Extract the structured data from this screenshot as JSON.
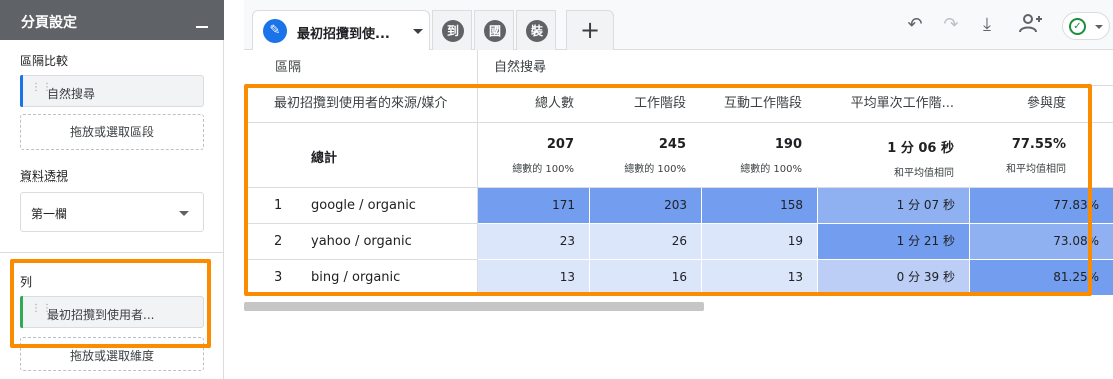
{
  "left_panel": {
    "title": "分頁設定",
    "segment_compare": {
      "label": "區隔比較",
      "chip": "自然搜尋",
      "drop": "拖放或選取區段"
    },
    "pivot": {
      "label": "資料透視",
      "value": "第一欄"
    },
    "rows": {
      "label": "列",
      "chip": "最初招攬到使用者...",
      "drop": "拖放或選取維度"
    }
  },
  "tabs": {
    "active_label": "最初招攬到使...",
    "mini": [
      "到",
      "國",
      "裝"
    ],
    "plus": "+"
  },
  "table": {
    "segment_header": "區隔",
    "segment_value": "自然搜尋",
    "dimension_header": "最初招攬到使用者的來源/媒介",
    "columns": [
      "總人數",
      "工作階段",
      "互動工作階段",
      "平均單次工作階...",
      "參與度"
    ],
    "totals_label": "總計",
    "totals": [
      {
        "value": "207",
        "sub": "總數的 100%"
      },
      {
        "value": "245",
        "sub": "總數的 100%"
      },
      {
        "value": "190",
        "sub": "總數的 100%"
      },
      {
        "value": "1 分 06 秒",
        "sub": "和平均值相同"
      },
      {
        "value": "77.55%",
        "sub": "和平均值相同"
      }
    ],
    "rows": [
      {
        "num": "1",
        "name": "google / organic",
        "cells": [
          "171",
          "203",
          "158",
          "1 分 07 秒",
          "77.83%"
        ]
      },
      {
        "num": "2",
        "name": "yahoo / organic",
        "cells": [
          "23",
          "26",
          "19",
          "1 分 21 秒",
          "73.08%"
        ]
      },
      {
        "num": "3",
        "name": "bing / organic",
        "cells": [
          "13",
          "16",
          "13",
          "0 分 39 秒",
          "81.25%"
        ]
      }
    ]
  },
  "colors": {
    "accent_orange": "#fb8c00",
    "heat_high": "#739dee",
    "heat_low": "#dbe6fb",
    "heat_mid": "#bccef5",
    "brand_blue": "#1a73e8"
  }
}
